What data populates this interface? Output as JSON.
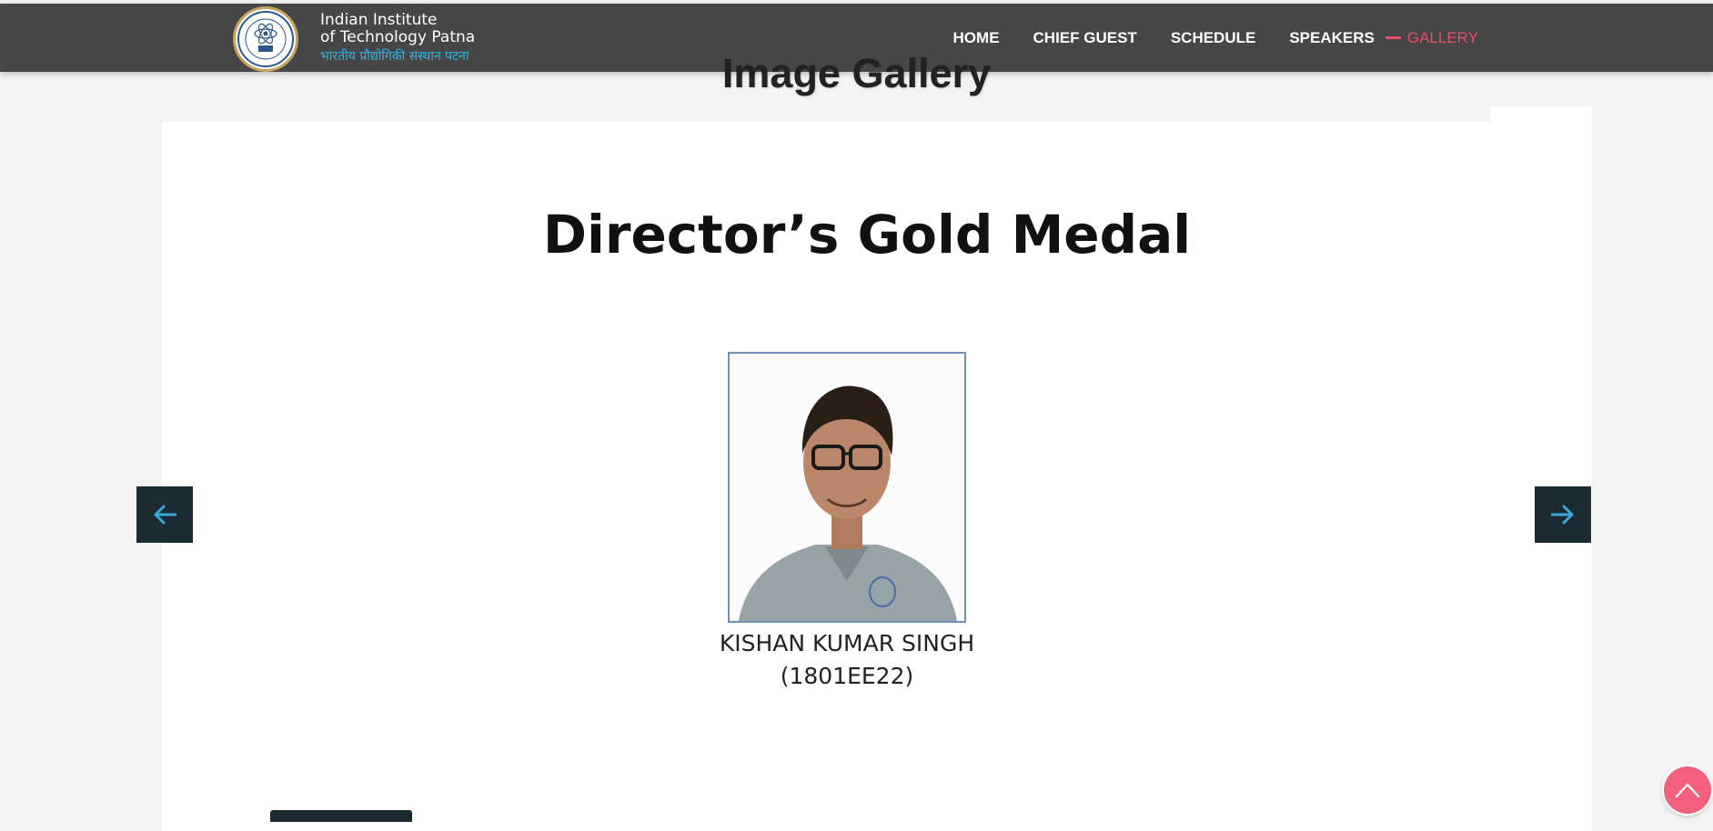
{
  "header": {
    "logo": {
      "line1": "Indian Institute",
      "line2": "of Technology  Patna",
      "line3": "भारतीय प्रौद्योगिकी संस्थान पटना"
    },
    "nav": [
      {
        "label": "HOME"
      },
      {
        "label": "CHIEF GUEST"
      },
      {
        "label": "SCHEDULE"
      },
      {
        "label": "SPEAKERS"
      },
      {
        "label": "GALLERY",
        "active": true
      }
    ]
  },
  "gallery": {
    "title": "Image Gallery",
    "slide": {
      "heading": "Director’s Gold Medal",
      "name": "KISHAN KUMAR SINGH",
      "roll": "(1801EE22)"
    }
  },
  "icons": {
    "prev": "arrow-left-icon",
    "next": "arrow-right-icon",
    "scroll_top": "chevron-up-icon"
  },
  "colors": {
    "navbar_bg": "#464646",
    "active_link": "#e94b6b",
    "arrow_button_bg": "#1c2a31",
    "arrow_icon": "#3aa7d9",
    "scroll_top_bg": "#f2607c",
    "logo_hindi": "#2db4e6"
  }
}
